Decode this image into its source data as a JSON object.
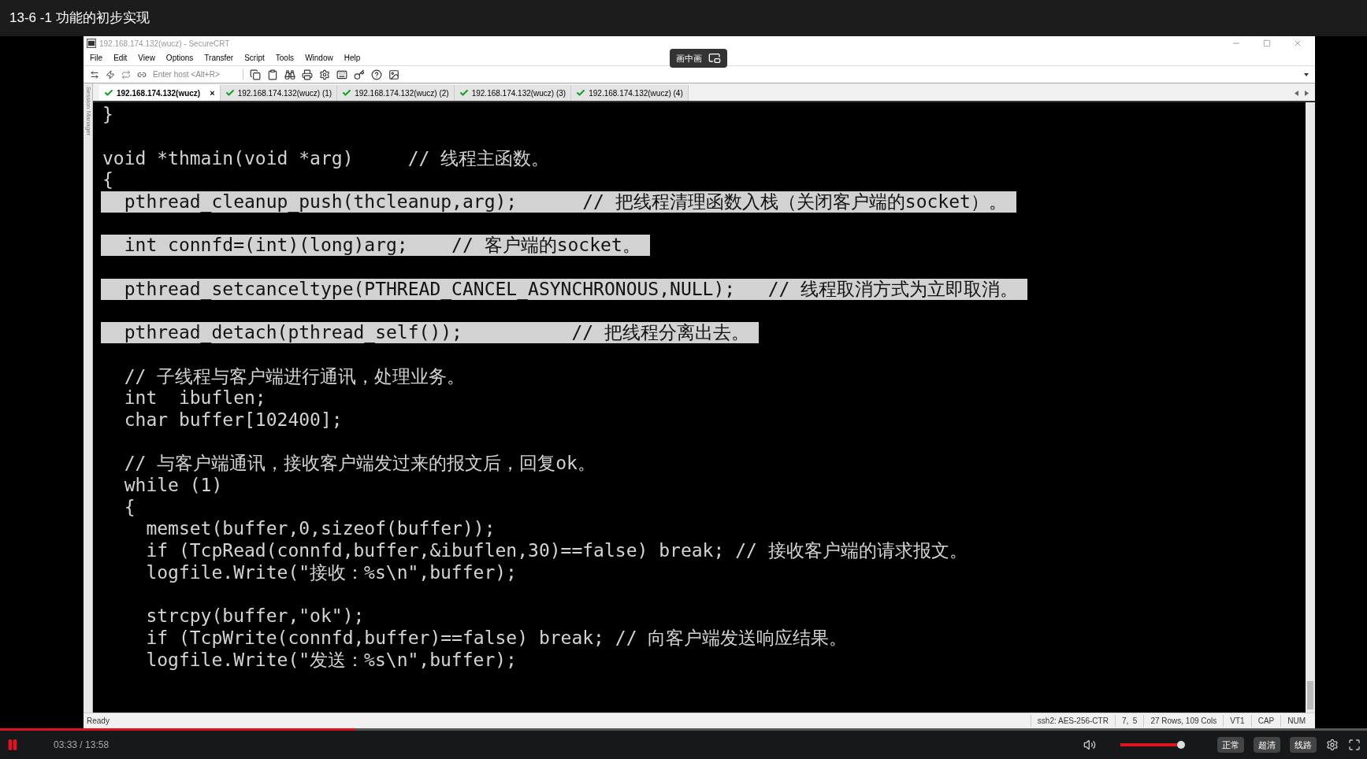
{
  "video_title": "13-6 -1 功能的初步实现",
  "window": {
    "title": "192.168.174.132(wucz) - SecureCRT"
  },
  "menu": [
    "File",
    "Edit",
    "View",
    "Options",
    "Transfer",
    "Script",
    "Tools",
    "Window",
    "Help"
  ],
  "toolbar": {
    "host_placeholder": "Enter host <Alt+R>"
  },
  "pip_label": "画中画",
  "tabs": [
    {
      "label": "192.168.174.132(wucz)",
      "selected": true,
      "connected": true,
      "close": "×"
    },
    {
      "label": "192.168.174.132(wucz) (1)",
      "selected": false,
      "connected": true
    },
    {
      "label": "192.168.174.132(wucz) (2)",
      "selected": false,
      "connected": true
    },
    {
      "label": "192.168.174.132(wucz) (3)",
      "selected": false,
      "connected": true
    },
    {
      "label": "192.168.174.132(wucz) (4)",
      "selected": false,
      "connected": true
    }
  ],
  "side_panel": "Session Manager",
  "terminal_lines": [
    {
      "kind": "code",
      "text": "}",
      "selected": false
    },
    {
      "kind": "blank"
    },
    {
      "kind": "code",
      "text": "void *thmain(void *arg)     // 线程主函数。",
      "selected": false
    },
    {
      "kind": "code",
      "text": "{",
      "selected": false
    },
    {
      "kind": "code",
      "text": "  pthread_cleanup_push(thcleanup,arg);      // 把线程清理函数入栈（关闭客户端的socket）。",
      "selected": true
    },
    {
      "kind": "blank"
    },
    {
      "kind": "code",
      "text": "  int connfd=(int)(long)arg;    // 客户端的socket。",
      "selected": true
    },
    {
      "kind": "blank"
    },
    {
      "kind": "code",
      "text": "  pthread_setcanceltype(PTHREAD_CANCEL_ASYNCHRONOUS,NULL);   // 线程取消方式为立即取消。",
      "selected": true
    },
    {
      "kind": "blank"
    },
    {
      "kind": "code",
      "text": "  pthread_detach(pthread_self());          // 把线程分离出去。",
      "selected": true
    },
    {
      "kind": "blank"
    },
    {
      "kind": "code",
      "text": "  // 子线程与客户端进行通讯，处理业务。",
      "selected": false
    },
    {
      "kind": "code",
      "text": "  int  ibuflen;",
      "selected": false
    },
    {
      "kind": "code",
      "text": "  char buffer[102400];",
      "selected": false
    },
    {
      "kind": "blank"
    },
    {
      "kind": "code",
      "text": "  // 与客户端通讯，接收客户端发过来的报文后，回复ok。",
      "selected": false
    },
    {
      "kind": "code",
      "text": "  while (1)",
      "selected": false
    },
    {
      "kind": "code",
      "text": "  {",
      "selected": false
    },
    {
      "kind": "code",
      "text": "    memset(buffer,0,sizeof(buffer));",
      "selected": false
    },
    {
      "kind": "code",
      "text": "    if (TcpRead(connfd,buffer,&ibuflen,30)==false) break; // 接收客户端的请求报文。",
      "selected": false
    },
    {
      "kind": "code",
      "text": "    logfile.Write(\"接收：%s\\n\",buffer);",
      "selected": false
    },
    {
      "kind": "blank"
    },
    {
      "kind": "code",
      "text": "    strcpy(buffer,\"ok\");",
      "selected": false
    },
    {
      "kind": "code",
      "text": "    if (TcpWrite(connfd,buffer)==false) break; // 向客户端发送响应结果。",
      "selected": false
    },
    {
      "kind": "code",
      "text": "    logfile.Write(\"发送：%s\\n\",buffer);",
      "selected": false
    }
  ],
  "status_bar": {
    "left": "Ready",
    "fields": [
      "ssh2: AES-256-CTR",
      "7,  5",
      "27 Rows, 109 Cols",
      "VT1",
      "CAP",
      "NUM"
    ]
  },
  "player": {
    "progress": {
      "level": 0.26
    },
    "time": "03:33 / 13:58",
    "volume": {
      "level": 0.96
    },
    "buttons": [
      "正常",
      "超清",
      "线路"
    ]
  }
}
